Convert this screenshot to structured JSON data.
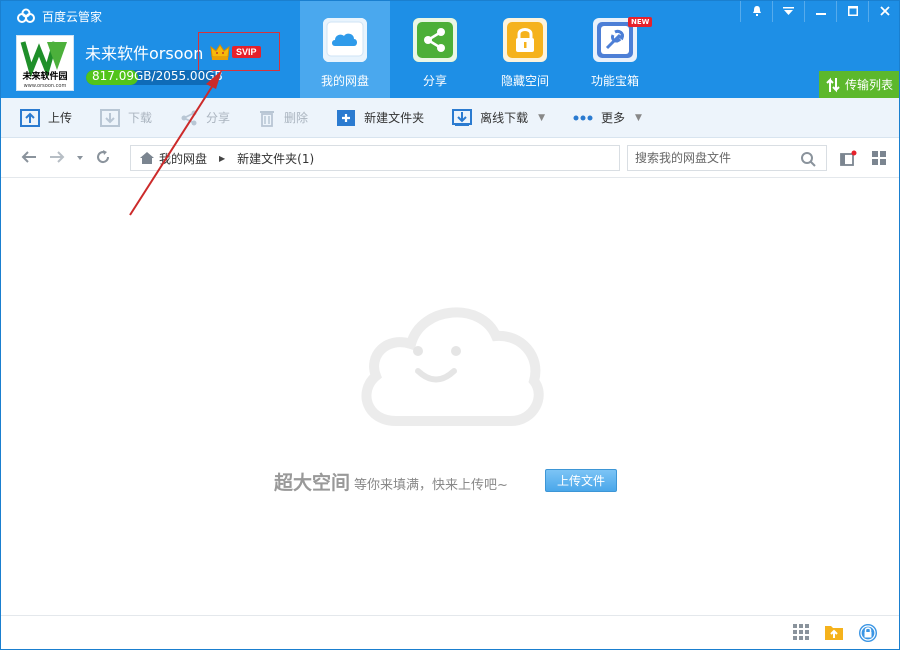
{
  "app": {
    "title": "百度云管家"
  },
  "user": {
    "name": "未来软件orsoon",
    "badge": "SVIP",
    "quota_used": "817.09GB",
    "quota_total": "/2055.00GB",
    "quota_fraction": 0.3976
  },
  "avatar": {
    "line1": "未来软件园",
    "line2": "www.orsoon.com"
  },
  "nav": [
    {
      "label": "我的网盘",
      "icon": "cloud-drive-icon"
    },
    {
      "label": "分享",
      "icon": "share-icon"
    },
    {
      "label": "隐藏空间",
      "icon": "lock-icon"
    },
    {
      "label": "功能宝箱",
      "icon": "toolbox-icon",
      "badge": "NEW"
    }
  ],
  "transfer": {
    "label": "传输列表"
  },
  "toolbar": {
    "upload": "上传",
    "download": "下载",
    "share": "分享",
    "delete": "删除",
    "new_folder": "新建文件夹",
    "offline_download": "离线下载",
    "more": "更多"
  },
  "breadcrumb": {
    "root": "我的网盘",
    "current": "新建文件夹(1)"
  },
  "search": {
    "placeholder": "搜索我的网盘文件"
  },
  "empty": {
    "big": "超大空间",
    "small": "等你来填满，快来上传吧~",
    "button": "上传文件"
  },
  "colors": {
    "header": "#1e8fe6",
    "active_nav": "#4aa8ee",
    "transfer": "#5cb82c",
    "badge": "#e6212b"
  }
}
